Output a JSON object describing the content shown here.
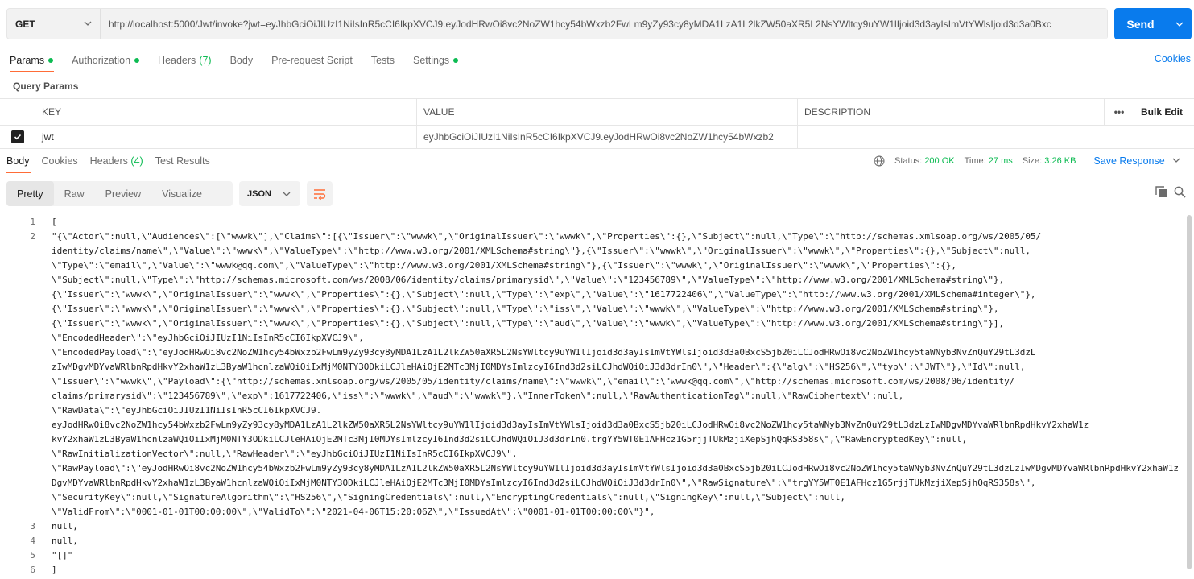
{
  "request": {
    "method": "GET",
    "url": "http://localhost:5000/Jwt/invoke?jwt=eyJhbGciOiJIUzI1NiIsInR5cCI6IkpXVCJ9.eyJodHRwOi8vc2NoZW1hcy54bWxzb2FwLm9yZy93cy8yMDA1LzA1L2lkZW50aXR5L2NsYWltcy9uYW1lIjoid3d3ayIsImVtYWlsIjoid3d3a0Bxc",
    "send_label": "Send"
  },
  "req_tabs": [
    {
      "label": "Params",
      "dot": true
    },
    {
      "label": "Authorization",
      "dot": true
    },
    {
      "label": "Headers",
      "count": "(7)"
    },
    {
      "label": "Body"
    },
    {
      "label": "Pre-request Script"
    },
    {
      "label": "Tests"
    },
    {
      "label": "Settings",
      "dot": true
    }
  ],
  "cookies_label": "Cookies",
  "query_params_label": "Query Params",
  "params_table": {
    "headers": [
      "KEY",
      "VALUE",
      "DESCRIPTION",
      "•••",
      "Bulk Edit"
    ],
    "row": {
      "key": "jwt",
      "value": "eyJhbGciOiJIUzI1NiIsInR5cCI6IkpXVCJ9.eyJodHRwOi8vc2NoZW1hcy54bWxzb2",
      "checked": true
    }
  },
  "resp_tabs": [
    {
      "label": "Body"
    },
    {
      "label": "Cookies"
    },
    {
      "label": "Headers",
      "count": "(4)"
    },
    {
      "label": "Test Results"
    }
  ],
  "status": {
    "status_label": "Status:",
    "status_value": "200 OK",
    "time_label": "Time:",
    "time_value": "27 ms",
    "size_label": "Size:",
    "size_value": "3.26 KB",
    "save_label": "Save Response"
  },
  "view_modes": [
    "Pretty",
    "Raw",
    "Preview",
    "Visualize"
  ],
  "format": "JSON",
  "code_lines": [
    {
      "num": "1",
      "text": "["
    },
    {
      "num": "2",
      "text": "    \"{\\\"Actor\\\":null,\\\"Audiences\\\":[\\\"wwwk\\\"],\\\"Claims\\\":[{\\\"Issuer\\\":\\\"wwwk\\\",\\\"OriginalIssuer\\\":\\\"wwwk\\\",\\\"Properties\\\":{},\\\"Subject\\\":null,\\\"Type\\\":\\\"http://schemas.xmlsoap.org/ws/2005/05/"
    },
    {
      "num": "",
      "text": "        identity/claims/name\\\",\\\"Value\\\":\\\"wwwk\\\",\\\"ValueType\\\":\\\"http://www.w3.org/2001/XMLSchema#string\\\"},{\\\"Issuer\\\":\\\"wwwk\\\",\\\"OriginalIssuer\\\":\\\"wwwk\\\",\\\"Properties\\\":{},\\\"Subject\\\":null,"
    },
    {
      "num": "",
      "text": "        \\\"Type\\\":\\\"email\\\",\\\"Value\\\":\\\"wwwk@qq.com\\\",\\\"ValueType\\\":\\\"http://www.w3.org/2001/XMLSchema#string\\\"},{\\\"Issuer\\\":\\\"wwwk\\\",\\\"OriginalIssuer\\\":\\\"wwwk\\\",\\\"Properties\\\":{},"
    },
    {
      "num": "",
      "text": "        \\\"Subject\\\":null,\\\"Type\\\":\\\"http://schemas.microsoft.com/ws/2008/06/identity/claims/primarysid\\\",\\\"Value\\\":\\\"123456789\\\",\\\"ValueType\\\":\\\"http://www.w3.org/2001/XMLSchema#string\\\"},"
    },
    {
      "num": "",
      "text": "        {\\\"Issuer\\\":\\\"wwwk\\\",\\\"OriginalIssuer\\\":\\\"wwwk\\\",\\\"Properties\\\":{},\\\"Subject\\\":null,\\\"Type\\\":\\\"exp\\\",\\\"Value\\\":\\\"1617722406\\\",\\\"ValueType\\\":\\\"http://www.w3.org/2001/XMLSchema#integer\\\"},"
    },
    {
      "num": "",
      "text": "        {\\\"Issuer\\\":\\\"wwwk\\\",\\\"OriginalIssuer\\\":\\\"wwwk\\\",\\\"Properties\\\":{},\\\"Subject\\\":null,\\\"Type\\\":\\\"iss\\\",\\\"Value\\\":\\\"wwwk\\\",\\\"ValueType\\\":\\\"http://www.w3.org/2001/XMLSchema#string\\\"},"
    },
    {
      "num": "",
      "text": "        {\\\"Issuer\\\":\\\"wwwk\\\",\\\"OriginalIssuer\\\":\\\"wwwk\\\",\\\"Properties\\\":{},\\\"Subject\\\":null,\\\"Type\\\":\\\"aud\\\",\\\"Value\\\":\\\"wwwk\\\",\\\"ValueType\\\":\\\"http://www.w3.org/2001/XMLSchema#string\\\"}],"
    },
    {
      "num": "",
      "text": "        \\\"EncodedHeader\\\":\\\"eyJhbGciOiJIUzI1NiIsInR5cCI6IkpXVCJ9\\\","
    },
    {
      "num": "",
      "text": "        \\\"EncodedPayload\\\":\\\"eyJodHRwOi8vc2NoZW1hcy54bWxzb2FwLm9yZy93cy8yMDA1LzA1L2lkZW50aXR5L2NsYWltcy9uYW1lIjoid3d3ayIsImVtYWlsIjoid3d3a0BxcS5jb20iLCJodHRwOi8vc2NoZW1hcy5taWNyb3NvZnQuY29tL3dzL"
    },
    {
      "num": "",
      "text": "        zIwMDgvMDYvaWRlbnRpdHkvY2xhaW1zL3ByaW1hcnlzaWQiOiIxMjM0NTY3ODkiLCJleHAiOjE2MTc3MjI0MDYsImlzcyI6Ind3d2siLCJhdWQiOiJ3d3drIn0\\\",\\\"Header\\\":{\\\"alg\\\":\\\"HS256\\\",\\\"typ\\\":\\\"JWT\\\"},\\\"Id\\\":null,"
    },
    {
      "num": "",
      "text": "        \\\"Issuer\\\":\\\"wwwk\\\",\\\"Payload\\\":{\\\"http://schemas.xmlsoap.org/ws/2005/05/identity/claims/name\\\":\\\"wwwk\\\",\\\"email\\\":\\\"wwwk@qq.com\\\",\\\"http://schemas.microsoft.com/ws/2008/06/identity/"
    },
    {
      "num": "",
      "text": "        claims/primarysid\\\":\\\"123456789\\\",\\\"exp\\\":1617722406,\\\"iss\\\":\\\"wwwk\\\",\\\"aud\\\":\\\"wwwk\\\"},\\\"InnerToken\\\":null,\\\"RawAuthenticationTag\\\":null,\\\"RawCiphertext\\\":null,"
    },
    {
      "num": "",
      "text": "        \\\"RawData\\\":\\\"eyJhbGciOiJIUzI1NiIsInR5cCI6IkpXVCJ9."
    },
    {
      "num": "",
      "text": "        eyJodHRwOi8vc2NoZW1hcy54bWxzb2FwLm9yZy93cy8yMDA1LzA1L2lkZW50aXR5L2NsYWltcy9uYW1lIjoid3d3ayIsImVtYWlsIjoid3d3a0BxcS5jb20iLCJodHRwOi8vc2NoZW1hcy5taWNyb3NvZnQuY29tL3dzLzIwMDgvMDYvaWRlbnRpdHkvY2xhaW1z"
    },
    {
      "num": "",
      "text": "        kvY2xhaW1zL3ByaW1hcnlzaWQiOiIxMjM0NTY3ODkiLCJleHAiOjE2MTc3MjI0MDYsImlzcyI6Ind3d2siLCJhdWQiOiJ3d3drIn0.trgYY5WT0E1AFHcz1G5rjjTUkMzjiXepSjhQqRS358s\\\",\\\"RawEncryptedKey\\\":null,"
    },
    {
      "num": "",
      "text": "        \\\"RawInitializationVector\\\":null,\\\"RawHeader\\\":\\\"eyJhbGciOiJIUzI1NiIsInR5cCI6IkpXVCJ9\\\","
    },
    {
      "num": "",
      "text": "        \\\"RawPayload\\\":\\\"eyJodHRwOi8vc2NoZW1hcy54bWxzb2FwLm9yZy93cy8yMDA1LzA1L2lkZW50aXR5L2NsYWltcy9uYW1lIjoid3d3ayIsImVtYWlsIjoid3d3a0BxcS5jb20iLCJodHRwOi8vc2NoZW1hcy5taWNyb3NvZnQuY29tL3dzLzIwMDgvMDYvaWRlbnRpdHkvY2xhaW1z"
    },
    {
      "num": "",
      "text": "        DgvMDYvaWRlbnRpdHkvY2xhaW1zL3ByaW1hcnlzaWQiOiIxMjM0NTY3ODkiLCJleHAiOjE2MTc3MjI0MDYsImlzcyI6Ind3d2siLCJhdWQiOiJ3d3drIn0\\\",\\\"RawSignature\\\":\\\"trgYY5WT0E1AFHcz1G5rjjTUkMzjiXepSjhQqRS358s\\\","
    },
    {
      "num": "",
      "text": "        \\\"SecurityKey\\\":null,\\\"SignatureAlgorithm\\\":\\\"HS256\\\",\\\"SigningCredentials\\\":null,\\\"EncryptingCredentials\\\":null,\\\"SigningKey\\\":null,\\\"Subject\\\":null,"
    },
    {
      "num": "",
      "text": "        \\\"ValidFrom\\\":\\\"0001-01-01T00:00:00\\\",\\\"ValidTo\\\":\\\"2021-04-06T15:20:06Z\\\",\\\"IssuedAt\\\":\\\"0001-01-01T00:00:00\\\"}\","
    },
    {
      "num": "3",
      "text": "    null,"
    },
    {
      "num": "4",
      "text": "    null,"
    },
    {
      "num": "5",
      "text": "    \"[]\""
    },
    {
      "num": "6",
      "text": "]"
    }
  ],
  "colors": {
    "accent": "#ff6c37",
    "primary": "#097bed",
    "success": "#0cbb52"
  }
}
